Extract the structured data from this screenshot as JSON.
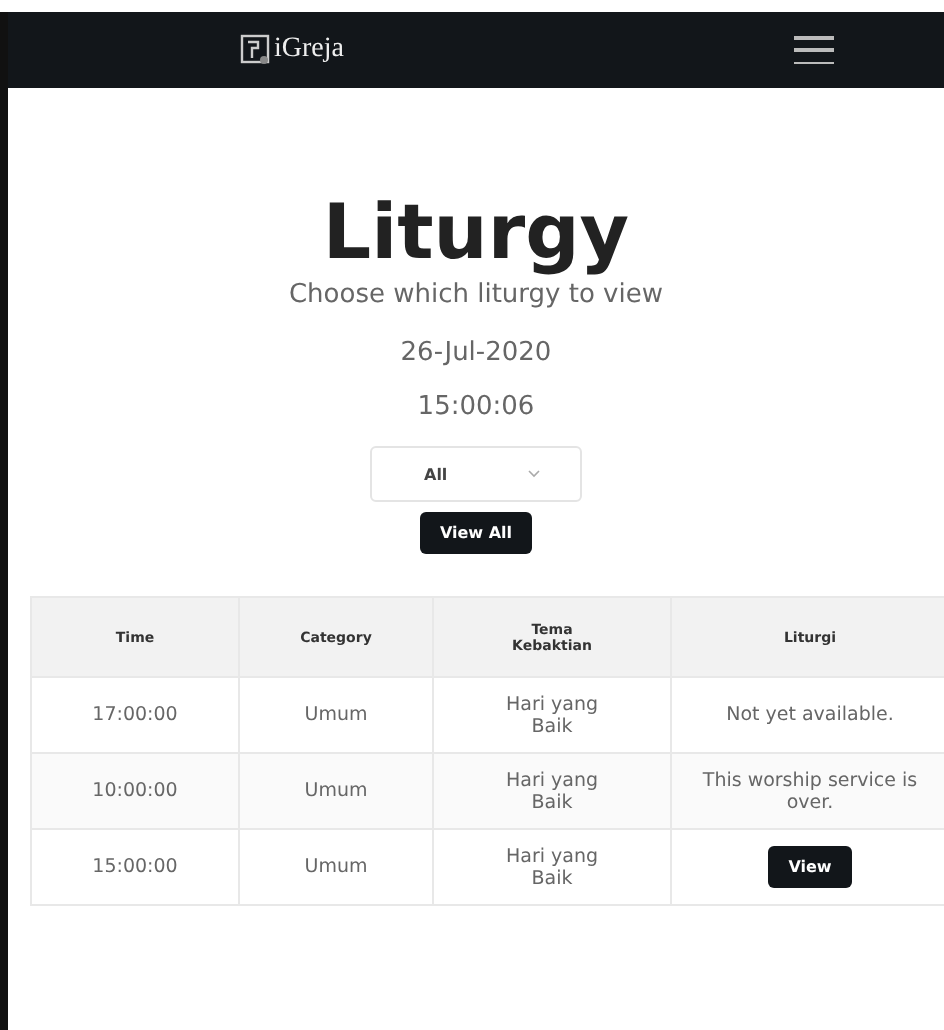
{
  "navbar": {
    "brand": "iGreja"
  },
  "header": {
    "title": "Liturgy",
    "subtitle": "Choose which liturgy to view",
    "date": "26-Jul-2020",
    "time": "15:00:06"
  },
  "filter": {
    "value": "All"
  },
  "view_all_button": "View All",
  "table": {
    "columns": [
      "Time",
      "Category",
      "Tema Kebaktian",
      "Liturgi"
    ],
    "rows": [
      {
        "time": "17:00:00",
        "category": "Umum",
        "tema": "Hari yang Baik",
        "liturgi": {
          "kind": "text",
          "text": "Not yet available."
        }
      },
      {
        "time": "10:00:00",
        "category": "Umum",
        "tema": "Hari yang Baik",
        "liturgi": {
          "kind": "text",
          "text": "This worship service is over."
        }
      },
      {
        "time": "15:00:00",
        "category": "Umum",
        "tema": "Hari yang Baik",
        "liturgi": {
          "kind": "button",
          "text": "View"
        }
      }
    ]
  }
}
